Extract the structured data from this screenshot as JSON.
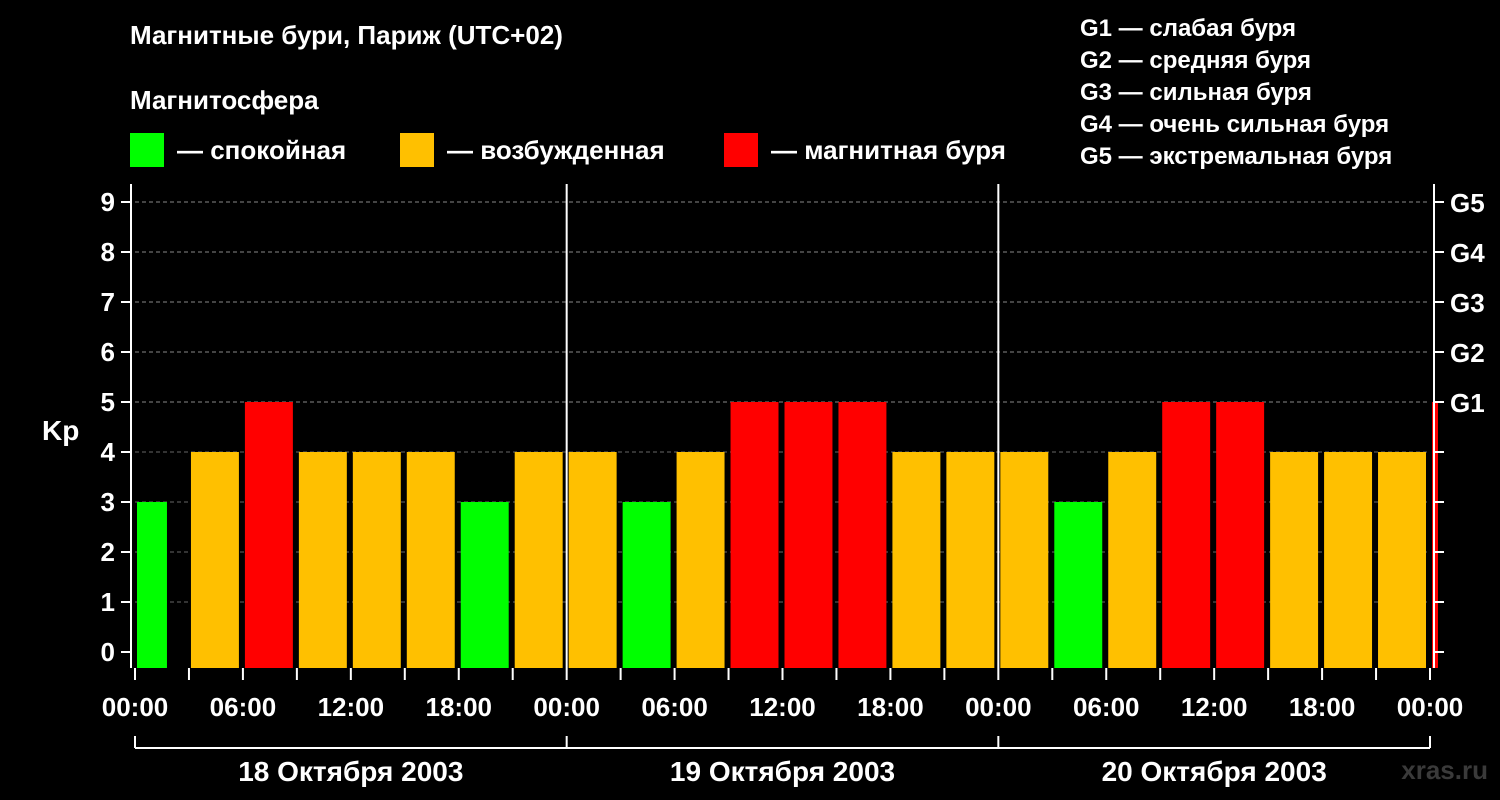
{
  "title": "Магнитные бури, Париж (UTC+02)",
  "magnetosphere": {
    "title": "Магнитосфера",
    "legend": [
      {
        "label": "— спокойная",
        "color": "#00ff00"
      },
      {
        "label": "— возбужденная",
        "color": "#ffc000"
      },
      {
        "label": "— магнитная буря",
        "color": "#ff0000"
      }
    ]
  },
  "g_scale": [
    "G1 — слабая буря",
    "G2 — средняя буря",
    "G3 — сильная буря",
    "G4 — очень сильная буря",
    "G5 — экстремальная буря"
  ],
  "watermark": "xras.ru",
  "chart_data": {
    "type": "bar",
    "ylabel": "Kp",
    "ylim": [
      0,
      9
    ],
    "yticks": [
      "0",
      "1",
      "2",
      "3",
      "4",
      "5",
      "6",
      "7",
      "8",
      "9"
    ],
    "right_ticks": [
      {
        "value": 5,
        "label": "G1"
      },
      {
        "value": 6,
        "label": "G2"
      },
      {
        "value": 7,
        "label": "G3"
      },
      {
        "value": 8,
        "label": "G4"
      },
      {
        "value": 9,
        "label": "G5"
      }
    ],
    "xticks": [
      "00:00",
      "06:00",
      "12:00",
      "18:00",
      "00:00",
      "06:00",
      "12:00",
      "18:00",
      "00:00",
      "06:00",
      "12:00",
      "18:00",
      "00:00"
    ],
    "days": [
      "18 Октября 2003",
      "19 Октября 2003",
      "20 Октября 2003"
    ],
    "interval_hours": 3,
    "values": [
      3,
      4,
      5,
      4,
      4,
      4,
      3,
      4,
      4,
      3,
      4,
      5,
      5,
      5,
      4,
      4,
      4,
      3,
      4,
      5,
      5,
      4,
      4,
      4,
      5
    ],
    "colors": {
      "quiet": "#00ff00",
      "active": "#ffc000",
      "storm": "#ff0000"
    },
    "grid": true
  }
}
